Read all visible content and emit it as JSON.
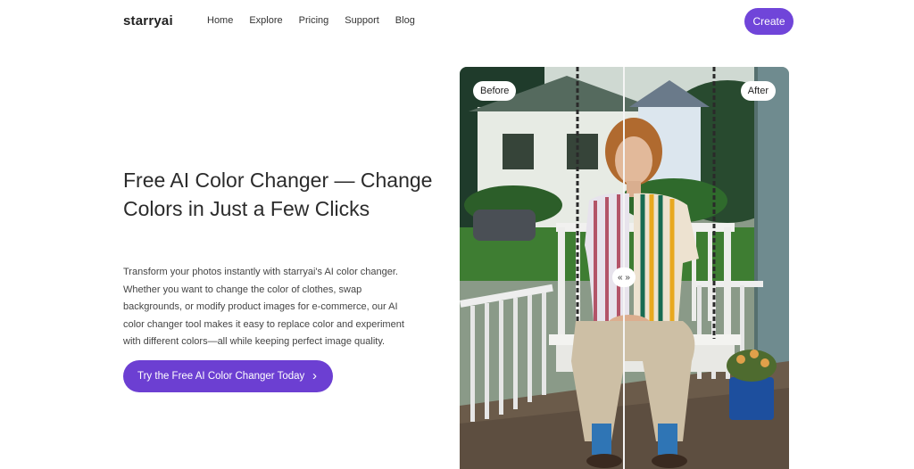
{
  "nav": {
    "logo": "starryai",
    "links": [
      "Home",
      "Explore",
      "Pricing",
      "Support",
      "Blog"
    ],
    "create_label": "Create"
  },
  "hero": {
    "title": "Free AI Color Changer — Change Colors in Just a Few Clicks",
    "description": "Transform your photos instantly with starryai's AI color changer. Whether you want to change the color of clothes, swap backgrounds, or modify product images for e-commerce, our AI color changer tool makes it easy to replace color and experiment with different colors—all while keeping perfect image quality.",
    "cta_label": "Try the Free AI Color Changer Today",
    "cta_icon": "chevron-right-icon"
  },
  "comparison": {
    "before_label": "Before",
    "after_label": "After",
    "handle_label": "« »"
  },
  "colors": {
    "accent": "#6c3fd2"
  }
}
